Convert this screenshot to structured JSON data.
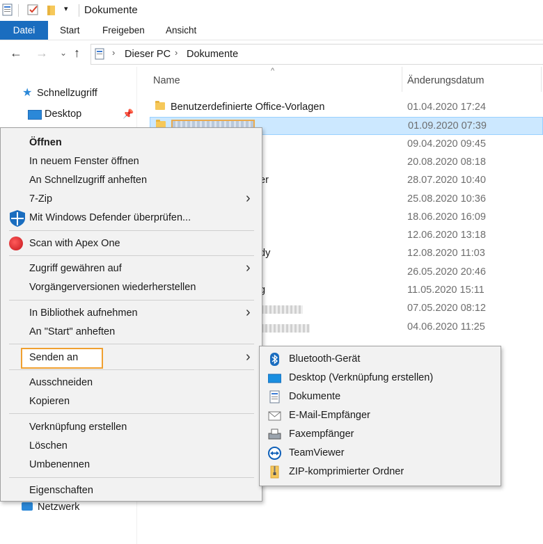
{
  "window": {
    "title": "Dokumente"
  },
  "ribbon": {
    "tabs": [
      "Datei",
      "Start",
      "Freigeben",
      "Ansicht"
    ]
  },
  "address": {
    "crumbs": [
      "Dieser PC",
      "Dokumente"
    ]
  },
  "nav": {
    "items": [
      {
        "label": "Schnellzugriff",
        "icon": "star-icon"
      },
      {
        "label": "Desktop",
        "icon": "desktop-icon"
      },
      {
        "label": "Netzwerk",
        "icon": "network-icon"
      }
    ]
  },
  "filelist": {
    "columns": {
      "name": "Name",
      "date": "Änderungsdatum"
    },
    "rows": [
      {
        "name": "Benutzerdefinierte Office-Vorlagen",
        "date": "01.04.2020 17:24"
      },
      {
        "name": "",
        "date": "01.09.2020 07:39",
        "selected": true
      },
      {
        "name": "",
        "date": "09.04.2020 09:45"
      },
      {
        "name": "",
        "date": "20.08.2020 08:18"
      },
      {
        "name": "er",
        "date": "28.07.2020 10:40"
      },
      {
        "name": "",
        "date": "25.08.2020 10:36"
      },
      {
        "name": "",
        "date": "18.06.2020 16:09"
      },
      {
        "name": "",
        "date": "12.06.2020 13:18"
      },
      {
        "name": "dy",
        "date": "12.08.2020 11:03"
      },
      {
        "name": "",
        "date": "26.05.2020 20:46"
      },
      {
        "name": "g",
        "date": "11.05.2020 15:11"
      },
      {
        "name": "",
        "date": "07.05.2020 08:12"
      },
      {
        "name": "",
        "date": "04.06.2020 11:25"
      }
    ]
  },
  "context_menu": {
    "items": {
      "oeffnen": "Öffnen",
      "neues_fenster": "In neuem Fenster öffnen",
      "schnellzugriff": "An Schnellzugriff anheften",
      "zip7": "7-Zip",
      "defender": "Mit Windows Defender überprüfen...",
      "apex": "Scan with Apex One",
      "zugriff": "Zugriff gewähren auf",
      "vorgaenger": "Vorgängerversionen wiederherstellen",
      "bibliothek": "In Bibliothek aufnehmen",
      "start": "An \"Start\" anheften",
      "senden": "Senden an",
      "ausschneiden": "Ausschneiden",
      "kopieren": "Kopieren",
      "verknuepfung": "Verknüpfung erstellen",
      "loeschen": "Löschen",
      "umbenennen": "Umbenennen",
      "eigenschaften": "Eigenschaften"
    }
  },
  "submenu": {
    "items": [
      {
        "label": "Bluetooth-Gerät",
        "icon": "bluetooth-icon"
      },
      {
        "label": "Desktop (Verknüpfung erstellen)",
        "icon": "desktop-icon"
      },
      {
        "label": "Dokumente",
        "icon": "documents-icon"
      },
      {
        "label": "E-Mail-Empfänger",
        "icon": "mail-icon"
      },
      {
        "label": "Faxempfänger",
        "icon": "fax-icon"
      },
      {
        "label": "TeamViewer",
        "icon": "teamviewer-icon"
      },
      {
        "label": "ZIP-komprimierter Ordner",
        "icon": "zip-folder-icon"
      }
    ]
  },
  "colors": {
    "accent": "#1a6dbf",
    "selection": "#cce8ff",
    "highlight_border": "#f0a030",
    "menu_bg": "#f2f2f2"
  }
}
